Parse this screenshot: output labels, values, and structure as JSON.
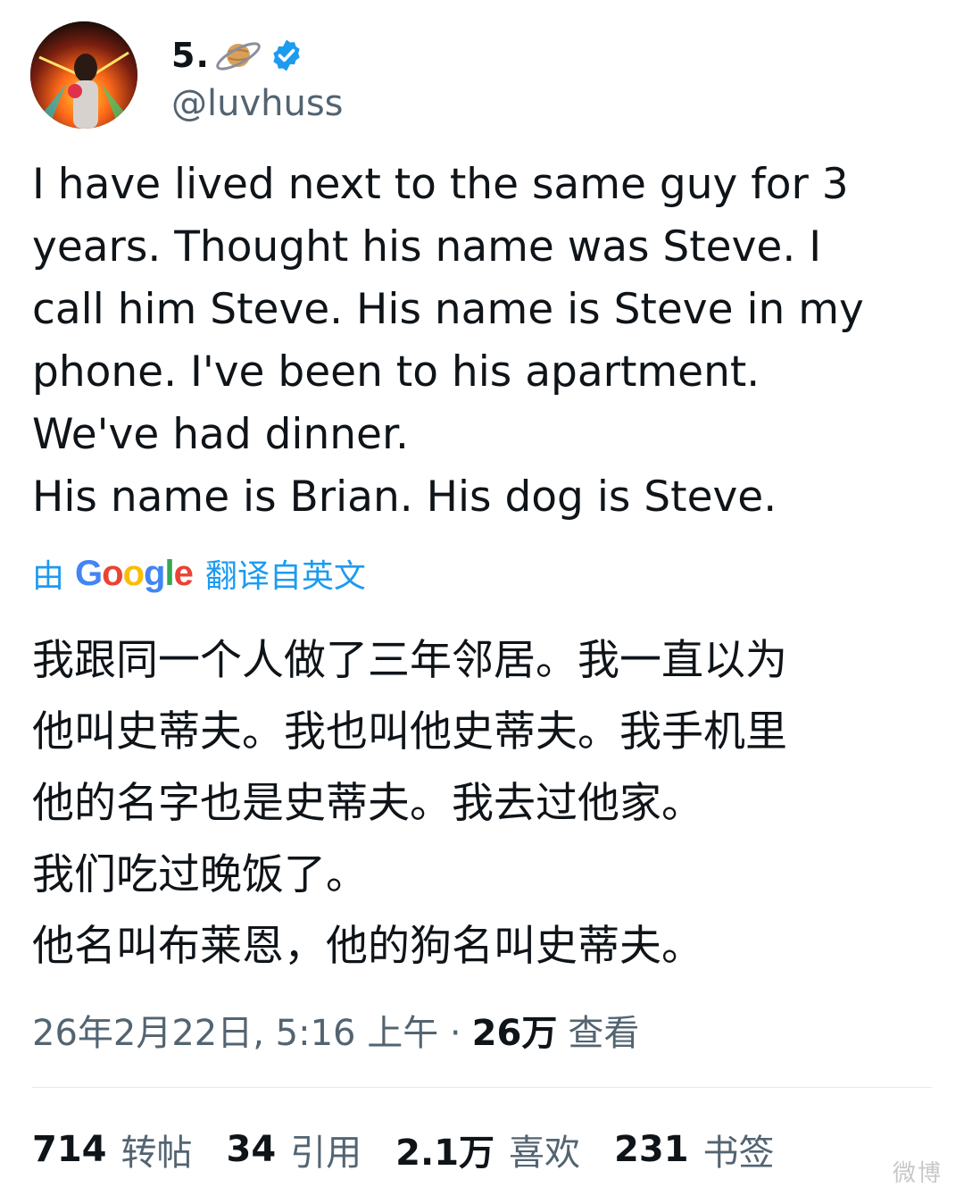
{
  "author": {
    "display_name": "5.",
    "handle": "@luvhuss",
    "verified_icon": "verified-badge-icon",
    "name_emoji": "saturn-planet-icon",
    "brand_color": "#1d9bf0"
  },
  "tweet": {
    "text_en": "I have lived next to the same guy for 3\nyears. Thought his name was Steve. I\ncall him Steve. His name is Steve in my\nphone. I've been to his apartment.\nWe've had dinner.\nHis name is Brian. His dog is Steve.",
    "translation": {
      "prefix": "由",
      "google": "Google",
      "suffix": "翻译自英文"
    },
    "text_zh": "我跟同一个人做了三年邻居。我一直以为\n他叫史蒂夫。我也叫他史蒂夫。我手机里\n他的名字也是史蒂夫。我去过他家。\n我们吃过晚饭了。\n他名叫布莱恩，他的狗名叫史蒂夫。"
  },
  "meta": {
    "timestamp": "26年2月22日, 5:16 上午 ·",
    "views_count": "26万",
    "views_label": "查看"
  },
  "stats": [
    {
      "count": "714",
      "label": "转帖"
    },
    {
      "count": "34",
      "label": "引用"
    },
    {
      "count": "2.1万",
      "label": "喜欢"
    },
    {
      "count": "231",
      "label": "书签"
    }
  ],
  "watermark": "微博"
}
